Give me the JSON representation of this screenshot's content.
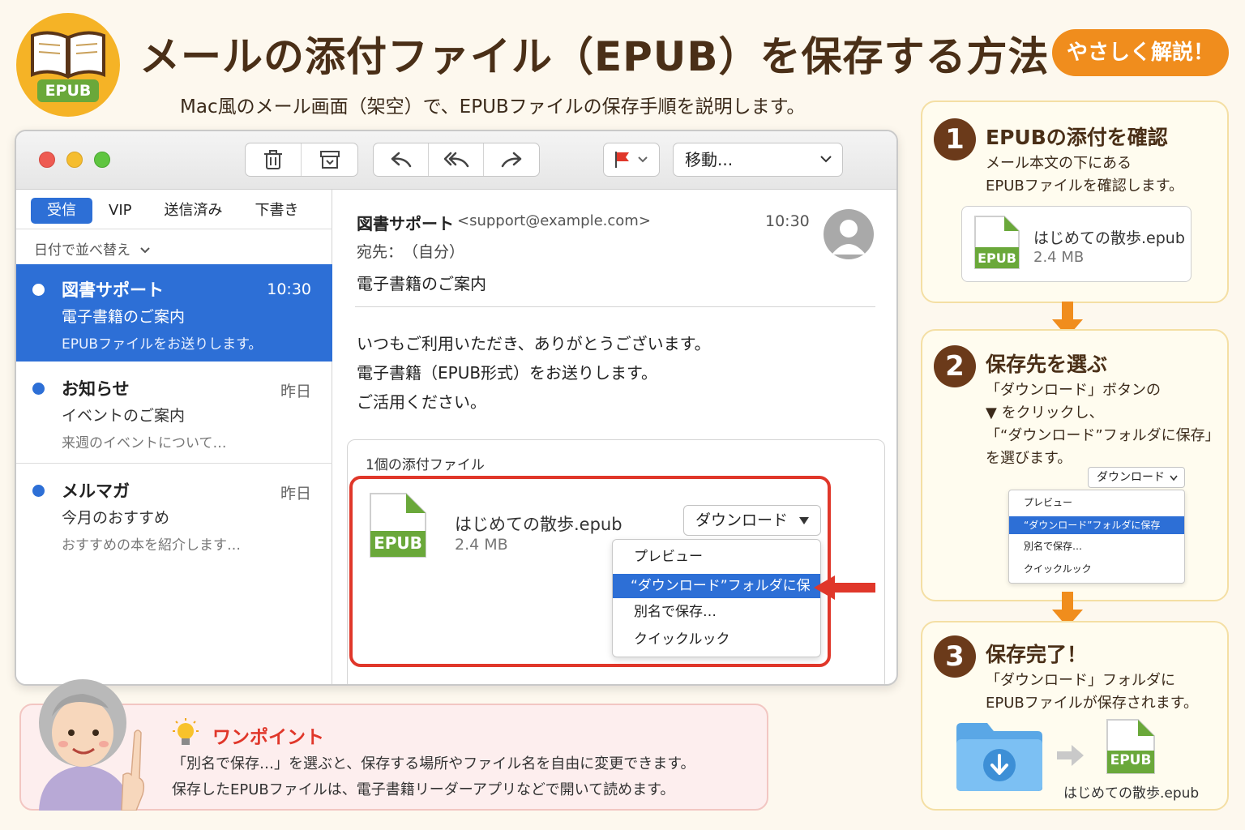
{
  "header": {
    "logo_badge": "EPUB",
    "title": "メールの添付ファイル（EPUB）を保存する方法",
    "badge": "やさしく解説！",
    "subtitle": "Mac風のメール画面（架空）で、EPUBファイルの保存手順を説明します。"
  },
  "toolbar": {
    "icons": [
      "trash-icon",
      "archive-icon",
      "reply-icon",
      "reply-all-icon",
      "forward-icon",
      "flag-icon"
    ],
    "move_label": "移動..."
  },
  "sidebar": {
    "tabs": [
      {
        "label": "受信",
        "active": true
      },
      {
        "label": "VIP",
        "active": false
      },
      {
        "label": "送信済み",
        "active": false
      },
      {
        "label": "下書き",
        "active": false
      }
    ],
    "sort_label": "日付で並べ替え",
    "messages": [
      {
        "from": "図書サポート",
        "time": "10:30",
        "subject": "電子書籍のご案内",
        "preview": "EPUBファイルをお送りします。",
        "selected": true
      },
      {
        "from": "お知らせ",
        "time": "昨日",
        "subject": "イベントのご案内",
        "preview": "来週のイベントについて…",
        "selected": false
      },
      {
        "from": "メルマガ",
        "time": "昨日",
        "subject": "今月のおすすめ",
        "preview": "おすすめの本を紹介します…",
        "selected": false
      }
    ]
  },
  "reader": {
    "from": "図書サポート",
    "address": "<support@example.com>",
    "time": "10:30",
    "to": "宛先：　（自分）",
    "subject": "電子書籍のご案内",
    "body": [
      "いつもご利用いただき、ありがとうございます。",
      "電子書籍（EPUB形式）をお送りします。",
      "ご活用ください。"
    ],
    "attachment": {
      "count_label": "1個の添付ファイル",
      "icon_label": "EPUB",
      "file_name": "はじめての散歩.epub",
      "file_size": "2.4 MB",
      "download_label": "ダウンロード",
      "menu": [
        "プレビュー",
        "“ダウンロード”フォルダに保存",
        "別名で保存…",
        "クイックルック"
      ],
      "highlighted_index": 1
    }
  },
  "tip": {
    "title": "ワンポイント",
    "lines": [
      "「別名で保存…」を選ぶと、保存する場所やファイル名を自由に変更できます。",
      "保存したEPUBファイルは、電子書籍リーダーアプリなどで開いて読めます。"
    ]
  },
  "steps": [
    {
      "number": "1",
      "title": "EPUBの添付を確認",
      "text": [
        "メール本文の下にある",
        "EPUBファイルを確認します。"
      ],
      "file_icon_label": "EPUB",
      "file_name": "はじめての散歩.epub",
      "file_size": "2.4 MB"
    },
    {
      "number": "2",
      "title": "保存先を選ぶ",
      "text": [
        "「ダウンロード」ボタンの",
        "▼ をクリックし、",
        "「“ダウンロード”フォルダに保存」",
        "を選びます。"
      ],
      "download_label": "ダウンロード",
      "menu": [
        "プレビュー",
        "“ダウンロード”フォルダに保存",
        "別名で保存…",
        "クイックルック"
      ]
    },
    {
      "number": "3",
      "title": "保存完了！",
      "text": [
        "「ダウンロード」フォルダに",
        "EPUBファイルが保存されます。"
      ],
      "file_icon_label": "EPUB",
      "file_name": "はじめての散歩.epub"
    }
  ],
  "colors": {
    "accent_blue": "#2d6fd6",
    "highlight_red": "#e0372a",
    "orange": "#f08d1d",
    "epub_green": "#6aa83a",
    "title_brown": "#4a2f17"
  }
}
